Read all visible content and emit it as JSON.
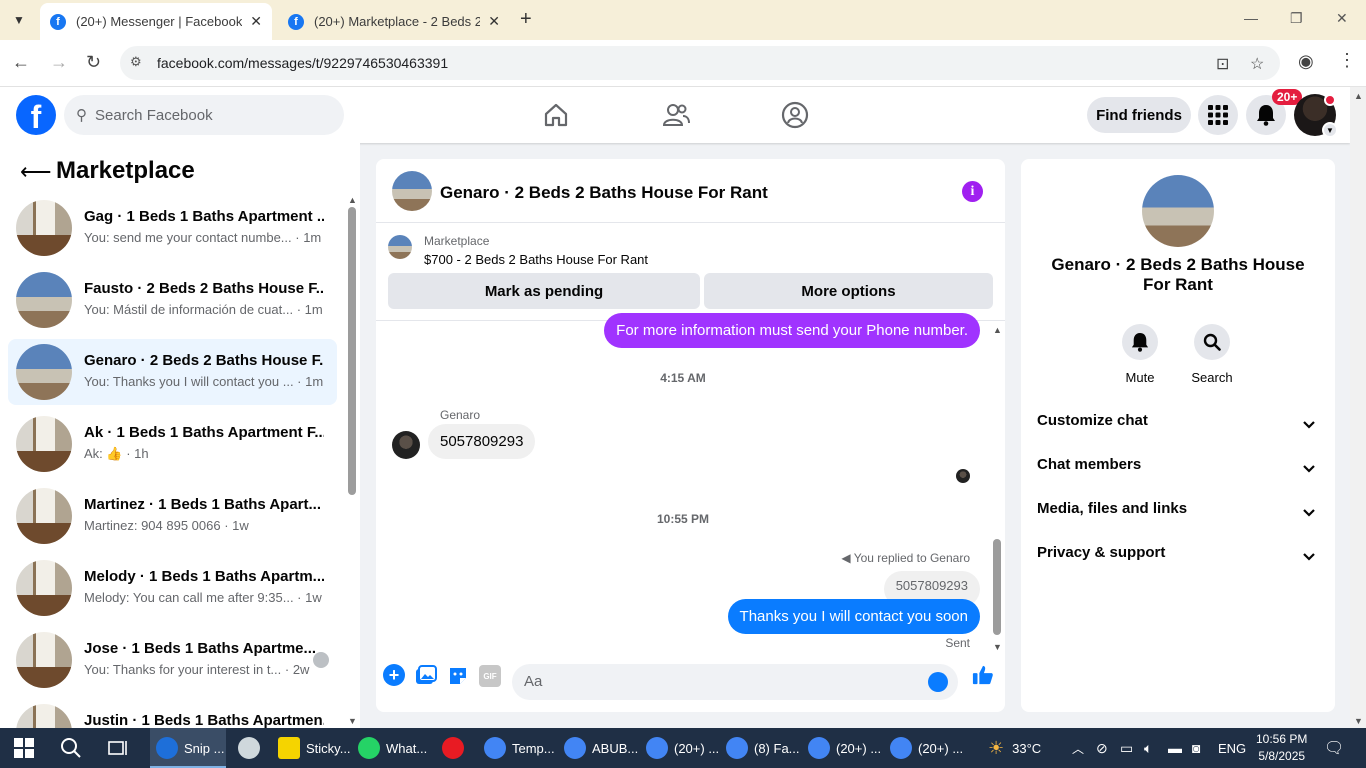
{
  "browser": {
    "tabs": [
      {
        "title": "(20+) Messenger | Facebook",
        "active": true
      },
      {
        "title": "(20+) Marketplace - 2 Beds 2 Baths",
        "active": false
      }
    ],
    "url": "facebook.com/messages/t/9229746530463391"
  },
  "header": {
    "search_placeholder": "Search Facebook",
    "find_friends": "Find friends",
    "notif_badge": "20+"
  },
  "sidebar": {
    "title": "Marketplace",
    "conversations": [
      {
        "name": "Gag · 1 Beds 1 Baths Apartment ...",
        "snippet": "You: send me your contact numbe... · 1m",
        "thumb": "room",
        "selected": false
      },
      {
        "name": "Fausto · 2 Beds 2 Baths House F...",
        "snippet": "You: Mástil de información de cuat... · 1m",
        "thumb": "house",
        "selected": false
      },
      {
        "name": "Genaro · 2 Beds 2 Baths House F...",
        "snippet": "You: Thanks you I will contact you ... · 1m",
        "thumb": "house",
        "selected": true
      },
      {
        "name": "Ak · 1 Beds 1 Baths Apartment F...",
        "snippet": "Ak: 👍 · 1h",
        "thumb": "room",
        "selected": false
      },
      {
        "name": "Martinez · 1 Beds 1 Baths Apart...",
        "snippet": "Martinez: 904 895 0066 · 1w",
        "thumb": "room",
        "selected": false
      },
      {
        "name": "Melody · 1 Beds 1 Baths Apartm...",
        "snippet": "Melody: You can call me after 9:35... · 1w",
        "thumb": "room",
        "selected": false
      },
      {
        "name": "Jose · 1 Beds 1 Baths Apartme...",
        "snippet": "You: Thanks for your interest in t... · 2w",
        "thumb": "room",
        "selected": false
      },
      {
        "name": "Justin · 1 Beds 1 Baths Apartmen...",
        "snippet": "",
        "thumb": "room",
        "selected": false
      }
    ]
  },
  "chat": {
    "title": "Genaro · 2 Beds 2 Baths House For Rant",
    "listing_label": "Marketplace",
    "listing_price": "$700 - 2 Beds 2 Baths House For Rant",
    "mark_pending": "Mark as pending",
    "more_options": "More options",
    "messages": {
      "out1": "For more information must send your Phone number.",
      "time1": "4:15 AM",
      "sender": "Genaro",
      "in1": "5057809293",
      "time2": "10:55 PM",
      "replied": "You replied to Genaro",
      "quoted": "5057809293",
      "out2": "Thanks you I will contact you soon",
      "status": "Sent"
    },
    "composer_placeholder": "Aa"
  },
  "details": {
    "title": "Genaro · 2 Beds 2 Baths House For Rant",
    "mute": "Mute",
    "search": "Search",
    "sections": [
      "Customize chat",
      "Chat members",
      "Media, files and links",
      "Privacy & support"
    ]
  },
  "taskbar": {
    "apps": [
      {
        "label": "Snip ...",
        "color": "#1e6fd9"
      },
      {
        "label": "",
        "color": "#cfd8dc"
      },
      {
        "label": "Sticky...",
        "color": "#f5d400"
      },
      {
        "label": "What...",
        "color": "#25d366"
      },
      {
        "label": "",
        "color": "#e81b23"
      },
      {
        "label": "Temp...",
        "color": "#4285f4"
      },
      {
        "label": "ABUB...",
        "color": "#4285f4"
      },
      {
        "label": "(20+) ...",
        "color": "#4285f4"
      },
      {
        "label": "(8) Fa...",
        "color": "#4285f4"
      },
      {
        "label": "(20+) ...",
        "color": "#4285f4"
      },
      {
        "label": "(20+) ...",
        "color": "#4285f4"
      }
    ],
    "weather": "33°C",
    "lang": "ENG",
    "time": "10:56 PM",
    "date": "5/8/2025"
  },
  "colors": {
    "brand": "#0866ff",
    "messenger_blue": "#0a7cff",
    "accent_purple": "#a033ff",
    "selected_bg": "#ebf5ff"
  }
}
